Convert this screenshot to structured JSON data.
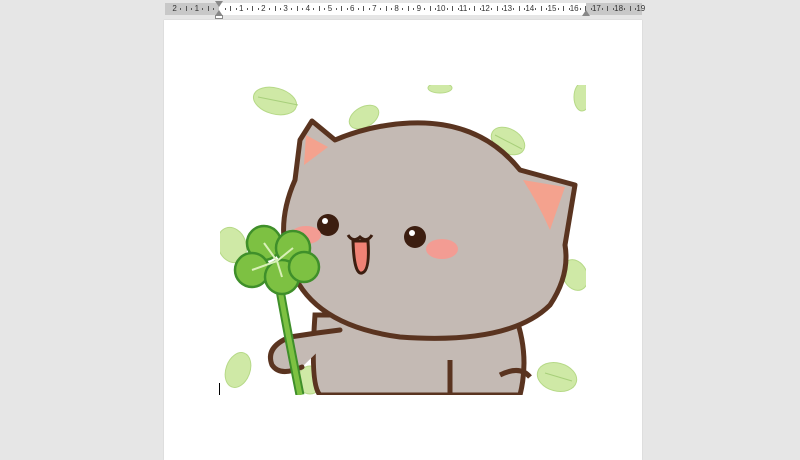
{
  "ruler": {
    "labels": [
      "2",
      "1",
      "1",
      "2",
      "3",
      "4",
      "5",
      "6",
      "7",
      "8",
      "9",
      "10",
      "11",
      "12",
      "13",
      "14",
      "15",
      "16",
      "17",
      "18",
      "19"
    ]
  },
  "document": {
    "image_description_icon": "cat-with-clover-image"
  },
  "colors": {
    "app_background": "#e6e6e6",
    "page": "#ffffff",
    "cat_fur": "#c4bab4",
    "cat_outline": "#5a3420",
    "clover": "#7dc142",
    "leaf": "#c8e6a0"
  }
}
